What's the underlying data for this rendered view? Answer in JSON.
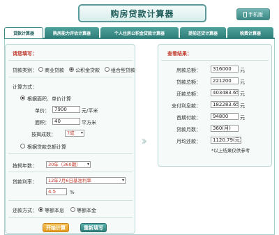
{
  "header": {
    "title": "购房贷款计算器",
    "mobile_label": "手机版"
  },
  "tabs": [
    {
      "label": "贷款计算器",
      "active": true
    },
    {
      "label": "购房能力评估计算器",
      "active": false
    },
    {
      "label": "个人住房公积金贷款计算器",
      "active": false
    },
    {
      "label": "提前还贷计算器",
      "active": false
    },
    {
      "label": "税费计算器",
      "active": false
    }
  ],
  "form": {
    "section_title": "请您填写：",
    "loan_type_label": "贷款类别：",
    "loan_types": [
      "商业贷款",
      "公积金贷款",
      "组合型贷款"
    ],
    "loan_type_selected": 1,
    "calc_method_label": "计算方式：",
    "method_area_label": "根据面积、单价计算",
    "unit_price_label": "单价：",
    "unit_price_value": "7900",
    "unit_price_unit": "元/平米",
    "area_label": "面积：",
    "area_value": "40",
    "area_unit": "平方米",
    "ratio_label": "按揭成数：",
    "ratio_value": "7成",
    "method_total_label": "根据贷款总额计算",
    "years_label": "按揭年数：",
    "years_value": "30年（360期）",
    "rate_label": "贷款利率：",
    "rate_select_value": "12年7月6日基准利率",
    "rate_value": "4.5",
    "rate_unit": "%",
    "repay_label": "还款方式：",
    "repay_options": [
      "等额本息",
      "等额本金"
    ],
    "repay_selected": 0,
    "start_button": "开始计算",
    "reset_button": "重新填写"
  },
  "results": {
    "section_title": "查看结果：",
    "rows": [
      {
        "label": "房款总额：",
        "value": "316000",
        "unit": "元"
      },
      {
        "label": "贷款总额：",
        "value": "221200",
        "unit": "元"
      },
      {
        "label": "还款总额：",
        "value": "403483.65",
        "unit": "元"
      },
      {
        "label": "支付利息款：",
        "value": "182283.65",
        "unit": "元"
      },
      {
        "label": "首期付款：",
        "value": "94800",
        "unit": "元"
      },
      {
        "label": "贷款月数：",
        "value": "360(月)",
        "unit": ""
      },
      {
        "label": "月均还款：",
        "value": "1120.79(元)",
        "unit": ""
      }
    ],
    "note": "*以上结果仅供参考"
  },
  "colors": {
    "accent": "#3d8985",
    "warning": "#c0392b",
    "orange_button": "#e49a1f"
  }
}
